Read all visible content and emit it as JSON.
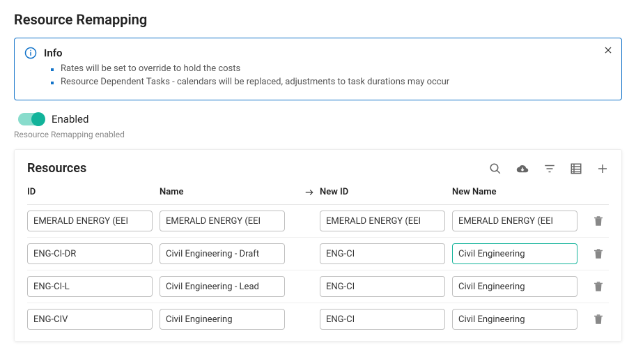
{
  "page_title": "Resource Remapping",
  "info": {
    "title": "Info",
    "items": [
      "Rates will be set to override to hold the costs",
      "Resource Dependent Tasks - calendars will be replaced, adjustments to task durations may occur"
    ]
  },
  "toggle": {
    "label": "Enabled",
    "caption": "Resource Remapping enabled"
  },
  "panel": {
    "title": "Resources",
    "columns": {
      "id": "ID",
      "name": "Name",
      "new_id": "New ID",
      "new_name": "New Name"
    },
    "rows": [
      {
        "id": "EMERALD ENERGY (EEI",
        "name": "EMERALD ENERGY (EEI",
        "new_id": "EMERALD ENERGY (EEI",
        "new_name": "EMERALD ENERGY (EEI",
        "highlight": false
      },
      {
        "id": "ENG-CI-DR",
        "name": "Civil Engineering - Draft",
        "new_id": "ENG-CI",
        "new_name": "Civil Engineering",
        "highlight": true
      },
      {
        "id": "ENG-CI-L",
        "name": "Civil Engineering - Lead",
        "new_id": "ENG-CI",
        "new_name": "Civil Engineering",
        "highlight": false
      },
      {
        "id": "ENG-CIV",
        "name": "Civil Engineering",
        "new_id": "ENG-CI",
        "new_name": "Civil Engineering",
        "highlight": false
      }
    ]
  }
}
